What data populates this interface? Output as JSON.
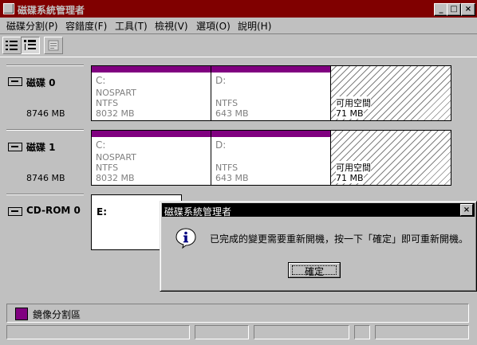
{
  "window": {
    "title": "磁碟系統管理者",
    "controls": {
      "minimize": "_",
      "maximize": "□",
      "close": "×"
    }
  },
  "menu": [
    "磁碟分割(P)",
    "容錯度(F)",
    "工具(T)",
    "檢視(V)",
    "選項(O)",
    "說明(H)"
  ],
  "toolbar": {
    "icons": [
      "volumes-view-icon",
      "disk-config-view-icon",
      "properties-icon"
    ]
  },
  "disks": [
    {
      "name": "磁碟 0",
      "size": "8746 MB",
      "partitions": [
        {
          "letter": "C:",
          "label": "NOSPART",
          "fs": "NTFS",
          "size": "8032 MB"
        },
        {
          "letter": "D:",
          "label": "",
          "fs": "NTFS",
          "size": "643 MB"
        }
      ],
      "free": {
        "label": "可用空間",
        "size": "71 MB"
      }
    },
    {
      "name": "磁碟 1",
      "size": "8746 MB",
      "partitions": [
        {
          "letter": "C:",
          "label": "NOSPART",
          "fs": "NTFS",
          "size": "8032 MB"
        },
        {
          "letter": "D:",
          "label": "",
          "fs": "NTFS",
          "size": "643 MB"
        }
      ],
      "free": {
        "label": "可用空間",
        "size": "71 MB"
      }
    }
  ],
  "cdrom": {
    "name": "CD-ROM 0",
    "letter": "E:"
  },
  "legend": {
    "label": "鏡像分割區",
    "color": "#800080"
  },
  "dialog": {
    "title": "磁碟系統管理者",
    "message": "已完成的變更需要重新開機，按一下「確定」即可重新開機。",
    "ok_label": "確定",
    "close": "×"
  },
  "colors": {
    "title_bar": "#800000",
    "mirror": "#800080",
    "dialog_title": "#000000"
  }
}
